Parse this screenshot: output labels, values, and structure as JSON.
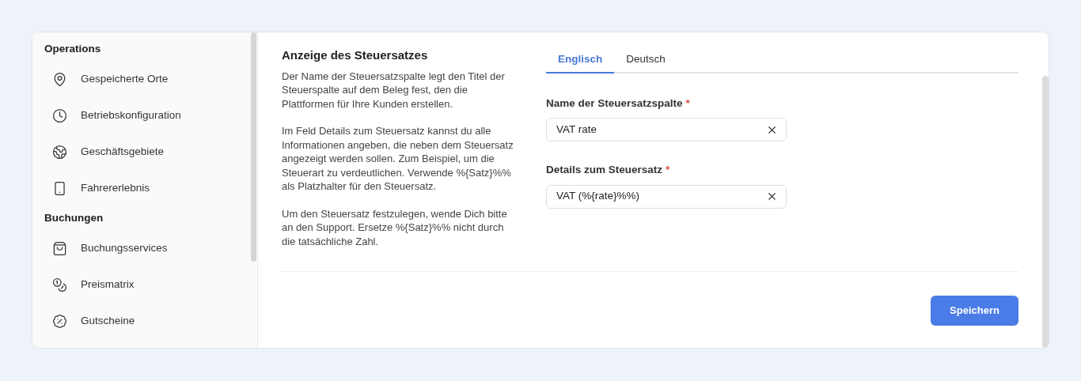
{
  "sidebar": {
    "sections": [
      {
        "title": "Operations",
        "items": [
          {
            "label": "Gespeicherte Orte"
          },
          {
            "label": "Betriebskonfiguration"
          },
          {
            "label": "Geschäftsgebiete"
          },
          {
            "label": "Fahrererlebnis"
          }
        ]
      },
      {
        "title": "Buchungen",
        "items": [
          {
            "label": "Buchungsservices"
          },
          {
            "label": "Preismatrix"
          },
          {
            "label": "Gutscheine"
          }
        ]
      }
    ]
  },
  "section": {
    "title": "Anzeige des Steuersatzes",
    "paragraphs": [
      "Der Name der Steuersatzspalte legt den Titel der Steuerspalte auf dem Beleg fest, den die Plattformen für Ihre Kunden erstellen.",
      "Im Feld Details zum Steuersatz kannst du alle Informationen angeben, die neben dem Steuersatz angezeigt werden sollen. Zum Beispiel, um die Steuerart zu verdeutlichen. Verwende %{Satz}%% als Platzhalter für den Steuersatz.",
      "Um den Steuersatz festzulegen, wende Dich bitte an den Support. Ersetze %{Satz}%% nicht durch die tatsächliche Zahl."
    ]
  },
  "tabs": [
    {
      "label": "Englisch",
      "selected": true
    },
    {
      "label": "Deutsch",
      "selected": false
    }
  ],
  "fields": [
    {
      "label": "Name der Steuersatzspalte",
      "required_mark": "*",
      "value": "VAT rate"
    },
    {
      "label": "Details zum Steuersatz",
      "required_mark": "*",
      "value": "VAT (%{rate}%%)"
    }
  ],
  "save_button": "Speichern"
}
